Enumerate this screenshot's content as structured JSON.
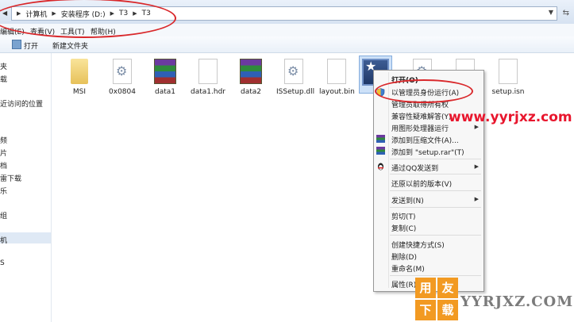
{
  "address": {
    "segments": [
      "计算机",
      "安装程序 (D:)",
      "T3",
      "T3"
    ]
  },
  "menu": [
    "编辑(E)",
    "查看(V)",
    "工具(T)",
    "帮助(H)"
  ],
  "toolbar": {
    "open": "打开",
    "new_folder": "新建文件夹"
  },
  "sidebar": [
    "夹",
    "载",
    "近访问的位置",
    "频",
    "片",
    "档",
    "雷下载",
    "乐",
    "组",
    "机",
    "S"
  ],
  "files": [
    {
      "name": "MSI",
      "icon": "folder-icon"
    },
    {
      "name": "0x0804",
      "icon": "settings-file-icon"
    },
    {
      "name": "data1",
      "icon": "winrar-archive-icon"
    },
    {
      "name": "data1.hdr",
      "icon": "blank-file-icon"
    },
    {
      "name": "data2",
      "icon": "winrar-archive-icon"
    },
    {
      "name": "ISSetup.dll",
      "icon": "dll-file-icon"
    },
    {
      "name": "layout.bin",
      "icon": "blank-file-icon"
    },
    {
      "name": "setup.isn",
      "icon": "blank-file-icon"
    }
  ],
  "context_menu": {
    "open": "打开(O)",
    "run_as_admin": "以管理员身份运行(A)",
    "take_ownership": "管理员取得所有权",
    "compat": "兼容性疑难解答(Y)",
    "gpu_run": "用图形处理器运行",
    "add_archive": "添加到压缩文件(A)...",
    "add_setup_rar": "添加到 \"setup.rar\"(T)",
    "qq_send": "通过QQ发送到",
    "restore": "还原以前的版本(V)",
    "send_to": "发送到(N)",
    "cut": "剪切(T)",
    "copy": "复制(C)",
    "shortcut": "创建快捷方式(S)",
    "delete": "删除(D)",
    "rename": "重命名(M)",
    "properties": "属性(R)"
  },
  "watermark": {
    "site1": "www.yyrjxz.com",
    "logo": [
      "用",
      "友",
      "下",
      "载"
    ],
    "site2": "YYRJXZ.COM"
  },
  "colors": {
    "annotation_red": "#d9282b",
    "watermark_red": "#e8162d",
    "logo_orange": "#f29a22"
  }
}
